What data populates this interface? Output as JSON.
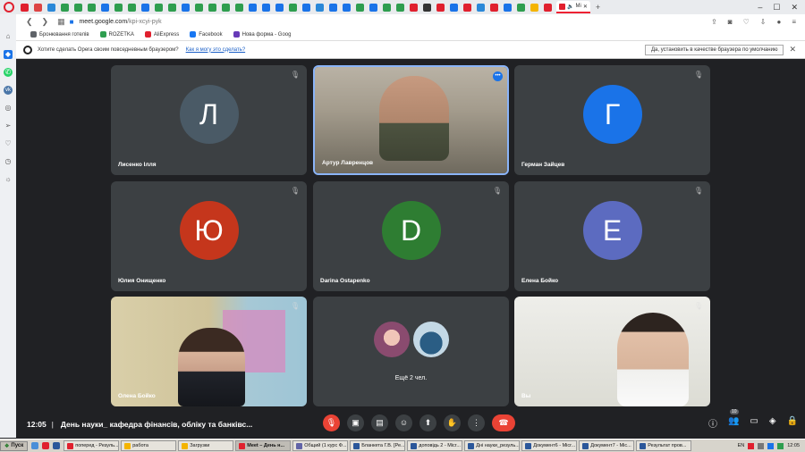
{
  "browser": {
    "tab_colors": [
      "#e0202e",
      "#d44",
      "#2a88d8",
      "#2e9e4f",
      "#2e9e4f",
      "#2e9e4f",
      "#1a73e8",
      "#2e9e4f",
      "#2e9e4f",
      "#1a73e8",
      "#2e9e4f",
      "#2e9e4f",
      "#1a73e8",
      "#2e9e4f",
      "#2e9e4f",
      "#2e9e4f",
      "#2e9e4f",
      "#1a73e8",
      "#1a73e8",
      "#1a73e8",
      "#2e9e4f",
      "#1a73e8",
      "#2a88d8",
      "#1a73e8",
      "#1a73e8",
      "#2e9e4f",
      "#1a73e8",
      "#2e9e4f",
      "#2e9e4f",
      "#e0202e",
      "#333",
      "#e0202e",
      "#1a73e8",
      "#e0202e",
      "#2a88d8",
      "#e0202e",
      "#1a73e8",
      "#2e9e4f",
      "#f4b400",
      "#e0202e"
    ],
    "active_tab_label": "Mi",
    "url_host": "meet.google.com",
    "url_path": "/kpi-xcyi-pyk",
    "bookmarks": [
      {
        "label": "Бронювання готелів",
        "color": "#5f6368"
      },
      {
        "label": "ROZETKA",
        "color": "#2e9e4f"
      },
      {
        "label": "AliExpress",
        "color": "#e0202e"
      },
      {
        "label": "Facebook",
        "color": "#1877f2"
      },
      {
        "label": "Нова форма - Goog",
        "color": "#673ab7"
      }
    ],
    "notify_text": "Хотите сделать Opera своим повседневным браузером?",
    "notify_link": "Как я могу это сделать?",
    "notify_button": "Да, установить в качестве браузера по умолчанию"
  },
  "meet": {
    "tiles": [
      {
        "name": "Лисенко Ілля",
        "initial": "Л",
        "color": "#4a5a66",
        "type": "avatar",
        "muted": true
      },
      {
        "name": "Артур Лавренцов",
        "initial": "",
        "color": "",
        "type": "video",
        "muted": false,
        "speaking": true
      },
      {
        "name": "Герман Зайцев",
        "initial": "Г",
        "color": "#1a73e8",
        "type": "avatar",
        "muted": true
      },
      {
        "name": "Юлия Онищенко",
        "initial": "Ю",
        "color": "#c5361c",
        "type": "avatar",
        "muted": true
      },
      {
        "name": "Darina Ostapenko",
        "initial": "D",
        "color": "#2e7d32",
        "type": "avatar",
        "muted": true
      },
      {
        "name": "Елена Бойко",
        "initial": "E",
        "color": "#5c6bc0",
        "type": "avatar",
        "muted": true
      },
      {
        "name": "Олена Бойко",
        "initial": "",
        "color": "",
        "type": "video",
        "muted": true
      },
      {
        "name": "",
        "initial": "",
        "color": "",
        "type": "more",
        "muted": false,
        "more_label": "Ещё 2 чел."
      },
      {
        "name": "Вы",
        "initial": "",
        "color": "",
        "type": "video",
        "muted": true
      }
    ],
    "time": "12:05",
    "title": "День науки_ кафедра фінансів, обліку та банківс...",
    "participants_count": "10"
  },
  "taskbar": {
    "start_label": "Пуск",
    "tasks": [
      {
        "label": "поперед - Резуль...",
        "color": "#e0202e",
        "active": false
      },
      {
        "label": "работа",
        "color": "#f4b400",
        "active": false
      },
      {
        "label": "Загрузки",
        "color": "#f4b400",
        "active": false
      },
      {
        "label": "Meet – День н...",
        "color": "#e0202e",
        "active": true
      },
      {
        "label": "Общий (1 курс Ф...",
        "color": "#6264a7",
        "active": false
      },
      {
        "label": "Бланкета Г.В. [Ре...",
        "color": "#2b579a",
        "active": false
      },
      {
        "label": "доповідь 2 - Micr...",
        "color": "#2b579a",
        "active": false
      },
      {
        "label": "Дні науки_резуль...",
        "color": "#2b579a",
        "active": false
      },
      {
        "label": "Документ6 - Micr...",
        "color": "#2b579a",
        "active": false
      },
      {
        "label": "Документ7 - Mic...",
        "color": "#2b579a",
        "active": false
      },
      {
        "label": "Результат пров...",
        "color": "#2b579a",
        "active": false
      }
    ],
    "lang": "EN",
    "clock": "12:05"
  }
}
